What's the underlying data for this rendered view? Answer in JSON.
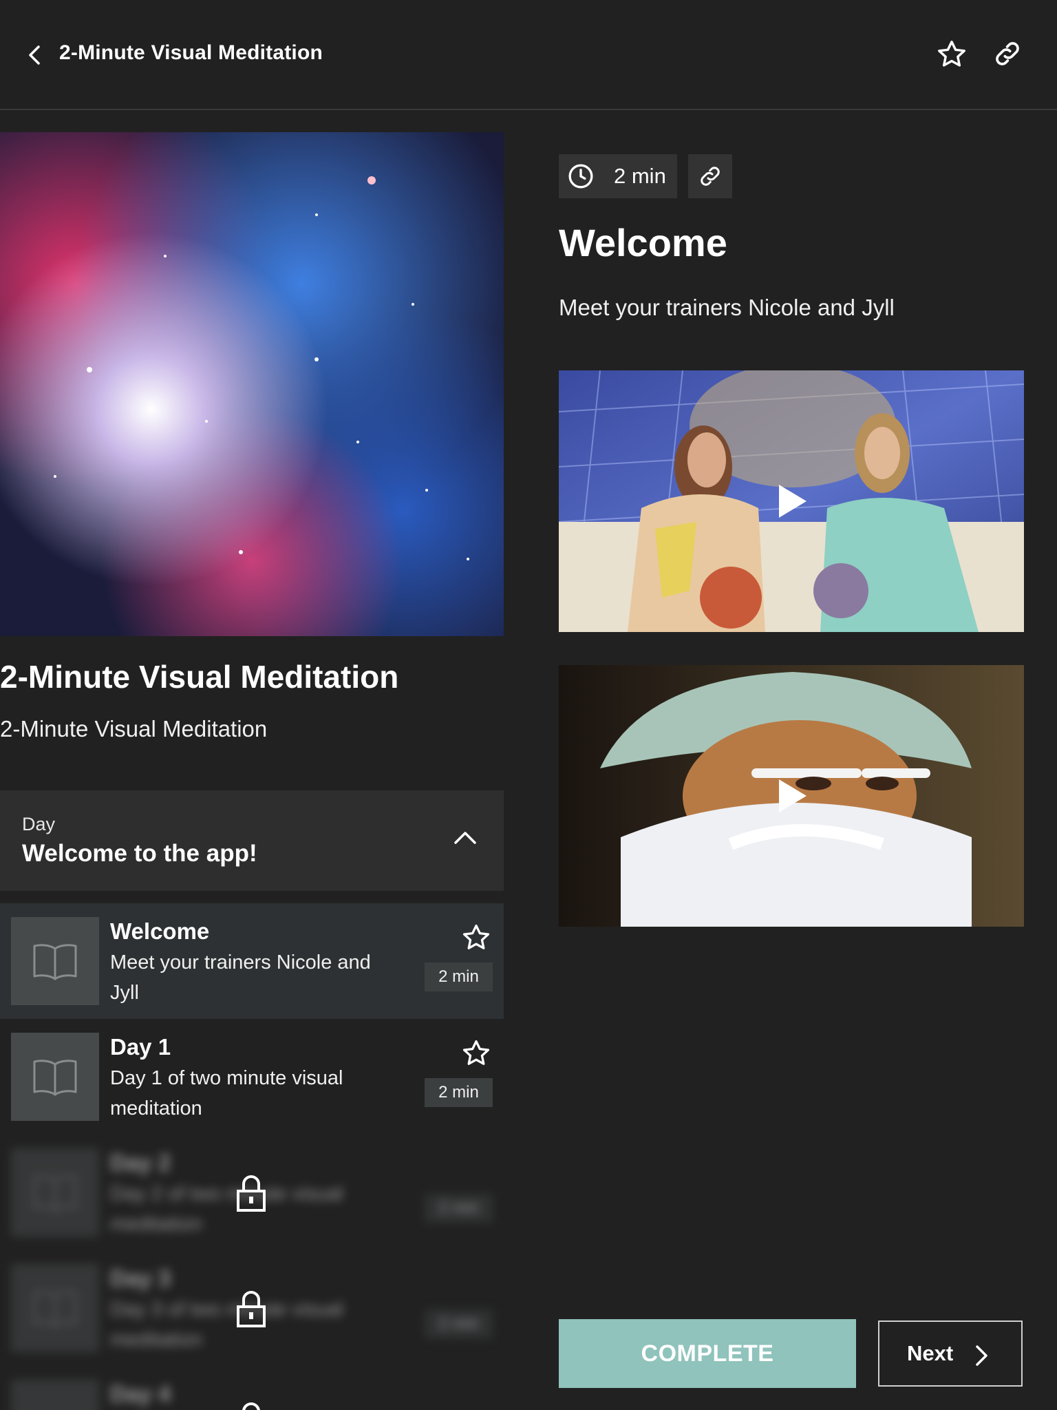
{
  "header": {
    "title": "2-Minute Visual Meditation",
    "back_icon": "chevron-left-icon",
    "favorite_icon": "star-outline-icon",
    "share_icon": "link-icon"
  },
  "program": {
    "title": "2-Minute Visual Meditation",
    "subtitle": "2-Minute Visual Meditation"
  },
  "day_section": {
    "label": "Day",
    "title": "Welcome to the app!"
  },
  "lessons": [
    {
      "title": "Welcome",
      "description": "Meet your trainers Nicole and Jyll",
      "duration": "2 min",
      "active": true,
      "locked": false
    },
    {
      "title": "Day 1",
      "description": "Day 1 of two minute visual meditation",
      "duration": "2 min",
      "active": false,
      "locked": false
    },
    {
      "title": "Day 2",
      "description": "Day 2 of two minute visual meditation",
      "duration": "2 min",
      "active": false,
      "locked": true
    },
    {
      "title": "Day 3",
      "description": "Day 3 of two minute visual meditation",
      "duration": "2 min",
      "active": false,
      "locked": true
    },
    {
      "title": "Day 4",
      "description": "",
      "duration": "",
      "active": false,
      "locked": true
    }
  ],
  "detail": {
    "duration": "2 min",
    "title": "Welcome",
    "subtitle": "Meet your trainers Nicole and Jyll"
  },
  "footer": {
    "complete_label": "COMPLETE",
    "next_label": "Next"
  },
  "colors": {
    "background": "#212121",
    "accent": "#8fc3bb",
    "active_row": "#2d3133"
  }
}
